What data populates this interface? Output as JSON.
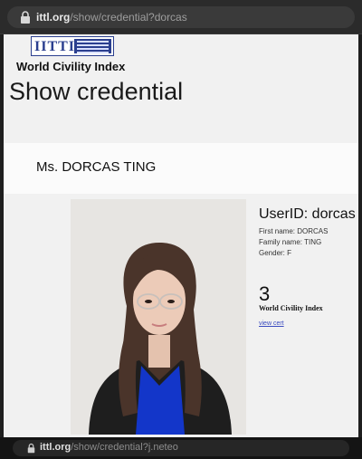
{
  "browser_top": {
    "url_host": "ittl.org",
    "url_path": "/show/credential?dorcas"
  },
  "page": {
    "logo_text": "IITTI",
    "brand": "World Civility Index",
    "title": "Show credential",
    "name": "Ms. DORCAS TING",
    "userid": "UserID: dorcas",
    "first_name": "First name: DORCAS",
    "family_name": "Family name: TING",
    "gender": "Gender: F",
    "count": "3",
    "count_label": "World Civility Index",
    "link_text": "view cert"
  },
  "browser_bottom": {
    "url_host": "ittl.org",
    "url_path": "/show/credential?j.neteo"
  },
  "colors": {
    "logo_blue": "#2b3f8f",
    "link": "#3b4cc0",
    "jacket": "#1e1e1e",
    "top": "#1336c9"
  },
  "icons": [
    "lock-icon"
  ]
}
